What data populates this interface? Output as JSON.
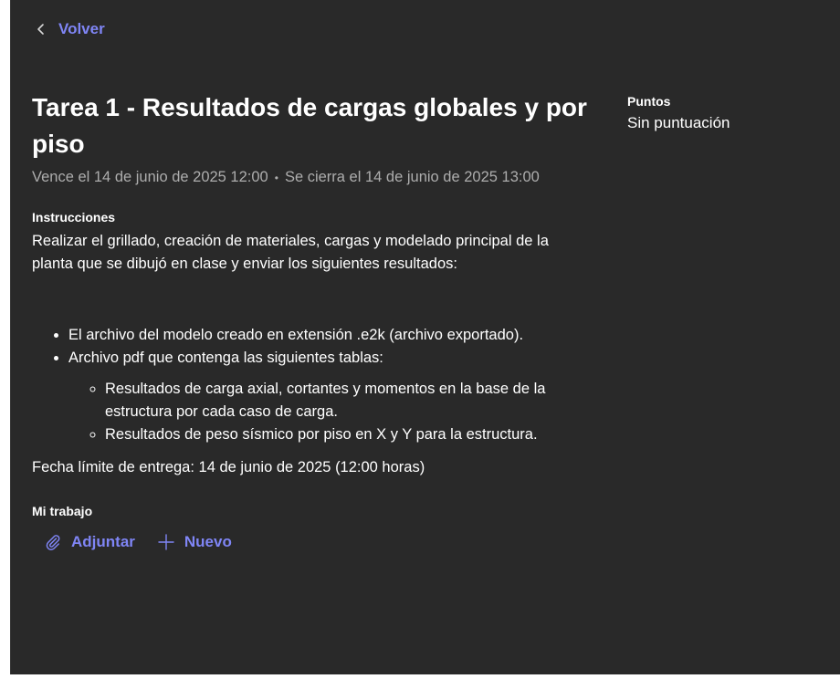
{
  "nav": {
    "back_label": "Volver"
  },
  "assignment": {
    "title": "Tarea 1 - Resultados de cargas globales y por piso",
    "due": "Vence el 14 de junio de 2025 12:00",
    "separator": "•",
    "closes": "Se cierra el 14 de junio de 2025 13:00",
    "instructions_label": "Instrucciones",
    "instructions_text": "Realizar el grillado, creación de materiales, cargas y modelado principal de la planta que se dibujó en clase y enviar los siguientes resultados:",
    "bullets": [
      "El archivo del modelo creado en extensión .e2k (archivo exportado).",
      "Archivo pdf que contenga las siguientes tablas:"
    ],
    "sub_bullets": [
      "Resultados de carga axial, cortantes y momentos en la base de la estructura por cada caso de carga.",
      "Resultados de peso sísmico por piso en X y Y para la estructura."
    ],
    "deadline": "Fecha límite de entrega: 14 de junio de 2025 (12:00 horas)"
  },
  "my_work": {
    "label": "Mi trabajo",
    "attach_label": "Adjuntar",
    "new_label": "Nuevo"
  },
  "points": {
    "label": "Puntos",
    "value": "Sin puntuación"
  },
  "colors": {
    "background": "#292929",
    "accent": "#7f85f5",
    "muted_text": "#adadad"
  }
}
